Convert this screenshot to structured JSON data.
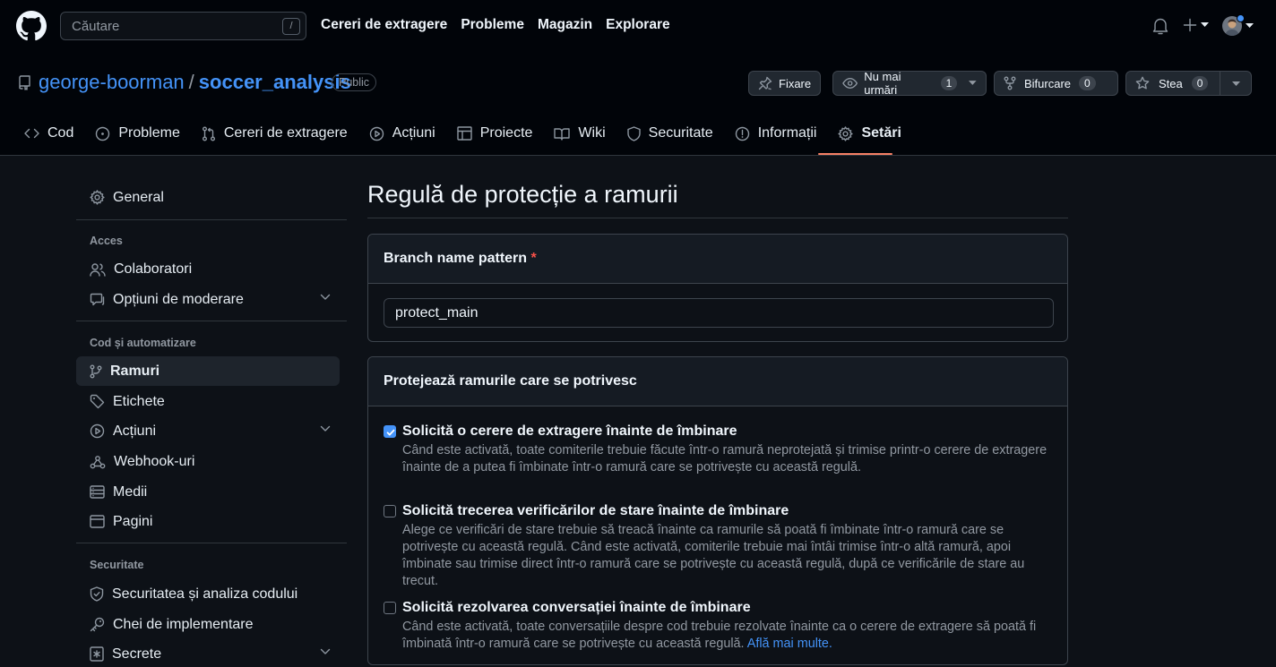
{
  "header": {
    "search_placeholder": "Căutare",
    "search_shortcut": "/",
    "nav": [
      "Cereri de extragere",
      "Probleme",
      "Magazin",
      "Explorare"
    ]
  },
  "repo": {
    "owner": "george-boorman",
    "separator": "/",
    "name": "soccer_analysis",
    "visibility": "Public",
    "pin_label": "Fixare",
    "watch_label": "Nu mai urmări",
    "watch_count": "1",
    "fork_label": "Bifurcare",
    "fork_count": "0",
    "star_label": "Stea",
    "star_count": "0"
  },
  "tabs": [
    {
      "label": "Cod",
      "icon": "code-icon"
    },
    {
      "label": "Probleme",
      "icon": "issue-icon"
    },
    {
      "label": "Cereri de extragere",
      "icon": "pull-request-icon"
    },
    {
      "label": "Acțiuni",
      "icon": "play-icon"
    },
    {
      "label": "Proiecte",
      "icon": "table-icon"
    },
    {
      "label": "Wiki",
      "icon": "book-icon"
    },
    {
      "label": "Securitate",
      "icon": "shield-icon"
    },
    {
      "label": "Informații",
      "icon": "graph-icon"
    },
    {
      "label": "Setări",
      "icon": "gear-icon",
      "active": true
    }
  ],
  "sidebar": {
    "general": "General",
    "groups": {
      "access": "Acces",
      "code": "Cod și automatizare",
      "security": "Securitate"
    },
    "items": {
      "collaborators": "Colaboratori",
      "moderation": "Opțiuni de moderare",
      "branches": "Ramuri",
      "tags": "Etichete",
      "actions": "Acțiuni",
      "webhooks": "Webhook-uri",
      "environments": "Medii",
      "pages": "Pagini",
      "code_security": "Securitatea și analiza codului",
      "deploy_keys": "Chei de implementare",
      "secrets": "Secrete"
    }
  },
  "main": {
    "title": "Regulă de protecție a ramurii",
    "pattern": {
      "heading": "Branch name pattern",
      "required_mark": "*",
      "value": "protect_main"
    },
    "protect": {
      "heading": "Protejează ramurile care se potrivesc",
      "options": [
        {
          "checked": true,
          "title": "Solicită o cerere de extragere înainte de îmbinare",
          "description": "Când este activată, toate comiterile trebuie făcute într-o ramură neprotejată și trimise printr-o cerere de extragere înainte de a putea fi îmbinate într-o ramură care se potrivește cu această regulă."
        },
        {
          "checked": false,
          "title": "Solicită trecerea verificărilor de stare înainte de îmbinare",
          "description": "Alege ce verificări de stare trebuie să treacă înainte ca ramurile să poată fi îmbinate într-o ramură care se potrivește cu această regulă. Când este activată, comiterile trebuie mai întâi trimise într-o altă ramură, apoi îmbinate sau trimise direct într-o ramură care se potrivește cu această regulă, după ce verificările de stare au trecut."
        },
        {
          "checked": false,
          "title": "Solicită rezolvarea conversației înainte de îmbinare",
          "description": "Când este activată, toate conversațiile despre cod trebuie rezolvate înainte ca o cerere de extragere să poată fi îmbinată într-o ramură care se potrivește cu această regulă.",
          "link": "Află mai multe."
        }
      ]
    }
  },
  "colors": {
    "background": "#0d1117",
    "header": "#010409",
    "accent": "#4493f8",
    "tab_underline": "#f78166"
  }
}
